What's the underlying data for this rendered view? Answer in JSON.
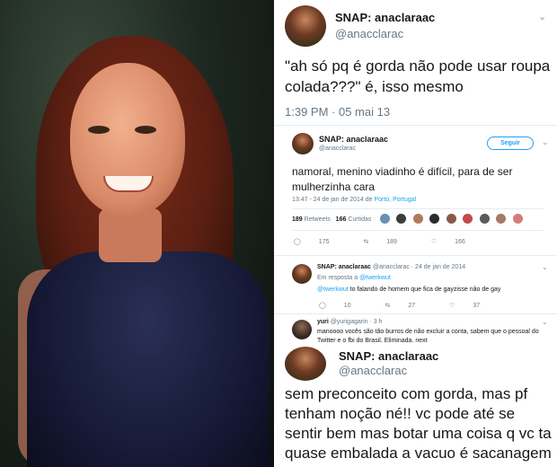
{
  "tweet1": {
    "name": "SNAP: anaclaraac",
    "handle": "@anacclarac",
    "text": "\"ah só pq é gorda não pode usar roupa colada???\" é, isso mesmo",
    "time": "1:39 PM · 05 mai 13"
  },
  "tweet2": {
    "name": "SNAP: anaclaraac",
    "handle": "@anacclarac",
    "follow_label": "Seguir",
    "text": "namoral, menino viadinho é difícil, para de ser mulherzinha cara",
    "meta_prefix": "13:47 - 24 de jan de 2014 de ",
    "meta_location": "Porto, Portugal",
    "retweets_count": "189",
    "retweets_label": "Retweets",
    "likes_count": "166",
    "likes_label": "Curtidas",
    "reply_count": "175",
    "rt_count": "189",
    "like_count": "166"
  },
  "reply1": {
    "name": "SNAP: anaclaraac",
    "handle_date": "@anacclarac · 24 de jan de 2014",
    "in_reply_prefix": "Em resposta a ",
    "in_reply_handle": "@twerkwut",
    "mention": "@twerkwut",
    "text": " to falando de homem que fica de gayzisse não de gay",
    "reply_count": "10",
    "rt_count": "27",
    "like_count": "37"
  },
  "reply2": {
    "name": "yuri",
    "handle_date": "@yurigagarin · 3 h",
    "text_line1": "manoooo vocês são tão burros de não excluir a conta, sabem que o pessoal do",
    "text_line2": "Twitter e o fbi do Brasil. Eliminada. next"
  },
  "tweet4": {
    "name": "SNAP: anaclaraac",
    "handle": "@anacclarac",
    "text": "sem preconceito com gorda, mas pf tenham noção né!! vc pode até se sentir bem mas botar uma coisa q vc ta quase embalada a vacuo é sacanagem"
  },
  "icons": {
    "chevron": "chevron-down-icon",
    "reply": "reply-icon",
    "retweet": "retweet-icon",
    "like": "heart-icon"
  },
  "colors": {
    "twitter_blue": "#1da1f2",
    "muted": "#657786",
    "divider": "#e6ecf0"
  }
}
